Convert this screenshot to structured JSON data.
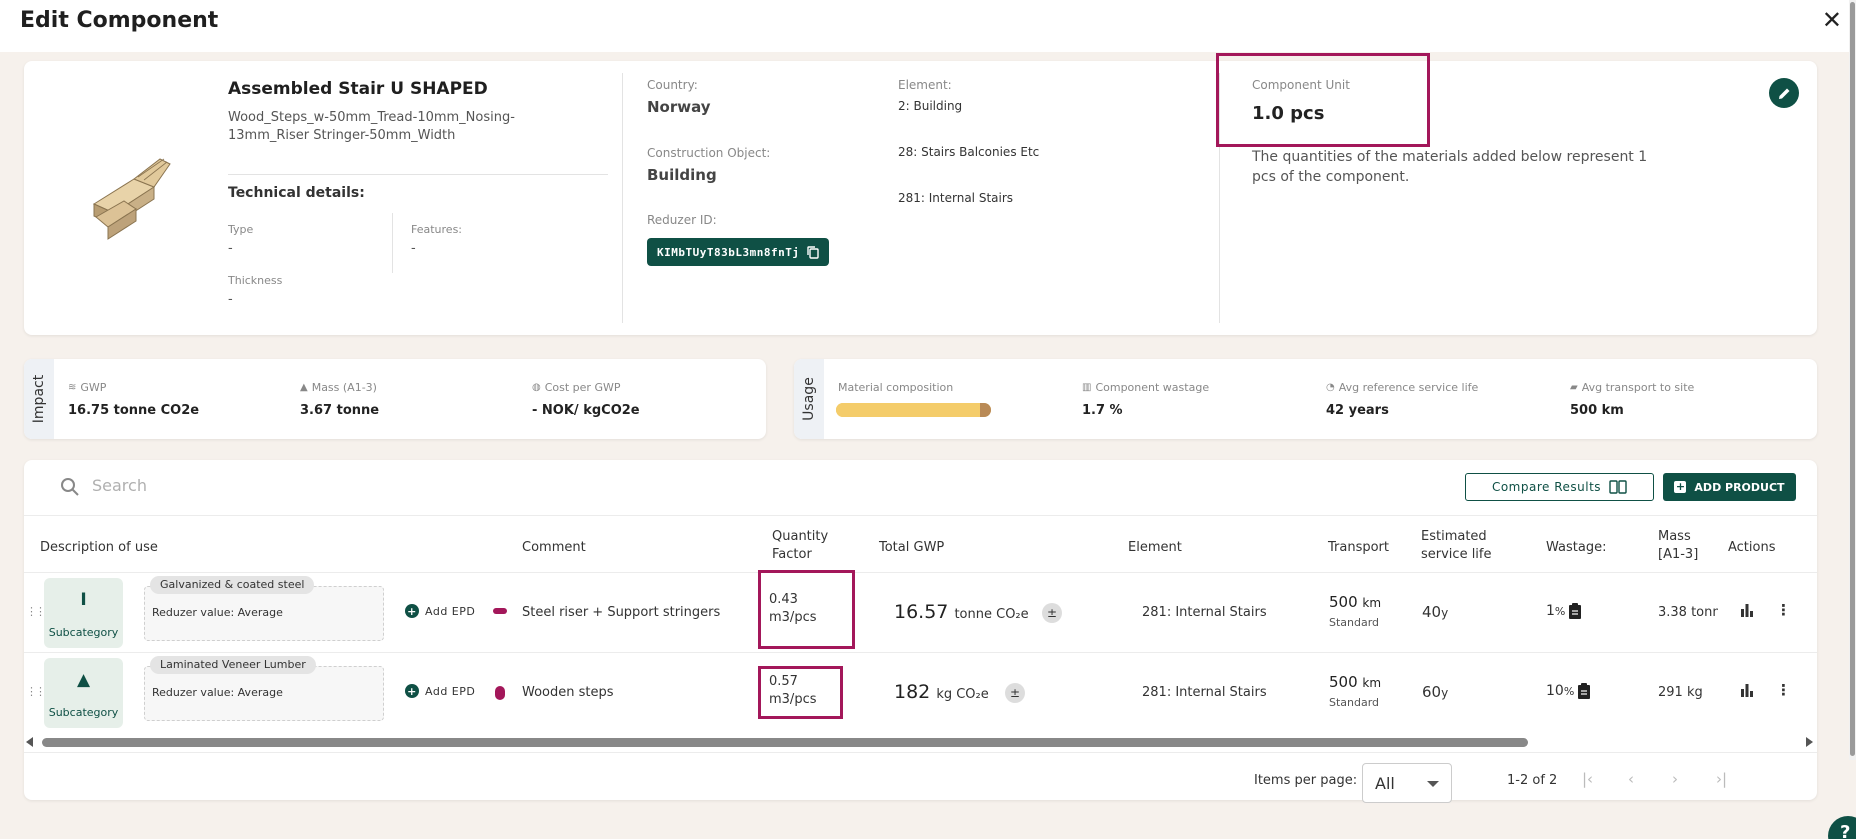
{
  "header": {
    "title": "Edit Component",
    "close_symbol": "✕"
  },
  "component": {
    "name": "Assembled Stair U SHAPED",
    "description": "Wood_Steps_w-50mm_Tread-10mm_Nosing-13mm_Riser Stringer-50mm_Width",
    "technical_title": "Technical details:",
    "type_label": "Type",
    "type_value": "-",
    "features_label": "Features:",
    "features_value": "-",
    "thickness_label": "Thickness",
    "thickness_value": "-",
    "country_label": "Country:",
    "country_value": "Norway",
    "construction_label": "Construction Object:",
    "construction_value": "Building",
    "reduzer_label": "Reduzer ID:",
    "reduzer_value": "KIMbTUyT83bL3mn8fnTj",
    "element_label": "Element:",
    "element_values": [
      "2: Building",
      "28: Stairs Balconies Etc",
      "281: Internal Stairs"
    ],
    "unit_label": "Component Unit",
    "unit_value": "1.0 pcs",
    "unit_text": "The quantities of the materials added below represent 1 pcs of the component."
  },
  "impact": {
    "tab": "Impact",
    "gwp_label": "GWP",
    "gwp_value": "16.75 tonne CO2e",
    "mass_label": "Mass (A1-3)",
    "mass_value": "3.67 tonne",
    "cost_label": "Cost per GWP",
    "cost_value": "- NOK/ kgCO2e"
  },
  "usage": {
    "tab": "Usage",
    "composition_label": "Material composition",
    "composition": [
      0.93,
      0.07
    ],
    "composition_colors": [
      "#f4cc6a",
      "#b98a56"
    ],
    "wastage_label": "Component wastage",
    "wastage_value": "1.7 %",
    "service_label": "Avg reference service life",
    "service_value": "42 years",
    "transport_label": "Avg transport to site",
    "transport_value": "500 km"
  },
  "toolbar": {
    "search_placeholder": "Search",
    "compare_label": "Compare Results",
    "add_label": "ADD PRODUCT"
  },
  "table": {
    "headers": {
      "description": "Description of use",
      "comment": "Comment",
      "quantity_1": "Quantity",
      "quantity_2": "Factor",
      "gwp": "Total GWP",
      "element": "Element",
      "transport": "Transport",
      "service_1": "Estimated",
      "service_2": "service life",
      "wastage": "Wastage:",
      "mass_1": "Mass",
      "mass_2": "[A1-3]",
      "actions": "Actions"
    },
    "rows": [
      {
        "subcat_icon": "I",
        "subcat_label": "Subcategory",
        "epd_chip": "Galvanized & coated steel",
        "epd_sub": "Reduzer value: Average",
        "add_epd": "Add EPD",
        "comment": "Steel riser + Support stringers",
        "qty_1": "0.43",
        "qty_2": "m3/pcs",
        "gwp_value": "16.57",
        "gwp_unit": "tonne CO₂e",
        "element": "281: Internal Stairs",
        "transport_value": "500",
        "transport_unit": "km",
        "transport_mode": "Standard",
        "service_value": "40",
        "service_unit": "y",
        "wastage_value": "1",
        "wastage_unit": "%",
        "mass": "3.38 tonne",
        "dot_color": "#a3175a"
      },
      {
        "subcat_icon": "▲",
        "subcat_label": "Subcategory",
        "epd_chip": "Laminated Veneer Lumber",
        "epd_sub": "Reduzer value: Average",
        "add_epd": "Add EPD",
        "comment": "Wooden steps",
        "qty_1": "0.57",
        "qty_2": "m3/pcs",
        "gwp_value": "182",
        "gwp_unit": "kg CO₂e",
        "element": "281: Internal Stairs",
        "transport_value": "500",
        "transport_unit": "km",
        "transport_mode": "Standard",
        "service_value": "60",
        "service_unit": "y",
        "wastage_value": "10",
        "wastage_unit": "%",
        "mass": "291 kg",
        "dot_color": "#a3175a"
      }
    ]
  },
  "pagination": {
    "label": "Items per page:",
    "selected": "All",
    "range": "1-2 of 2"
  },
  "colors": {
    "brand": "#0f5045",
    "highlight": "#a3175a",
    "background": "#f6f1ec"
  },
  "help": {
    "label": "?"
  }
}
